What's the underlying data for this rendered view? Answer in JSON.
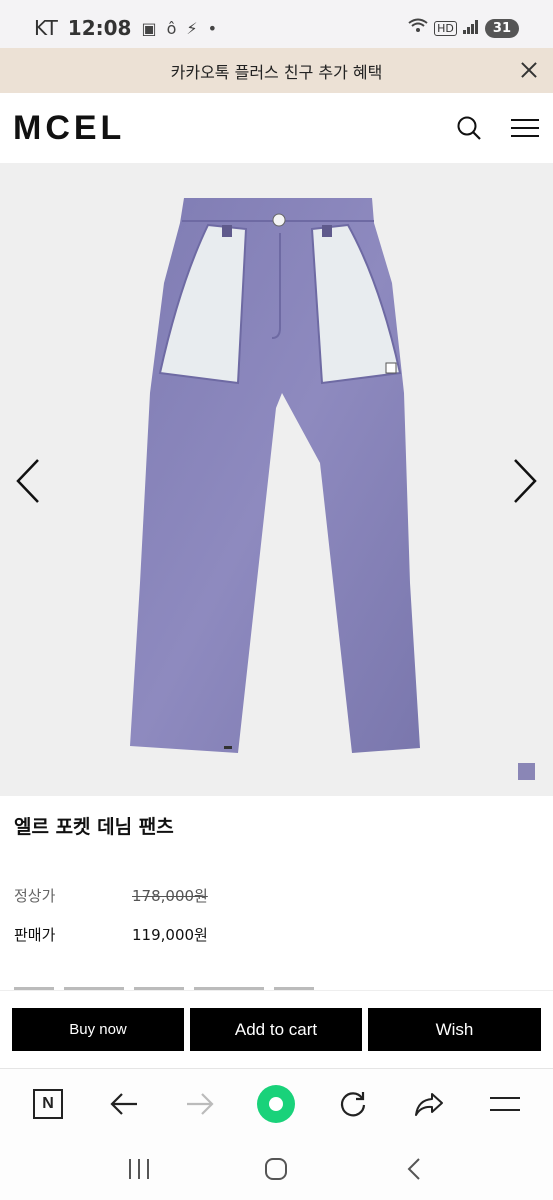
{
  "status_bar": {
    "carrier": "KT",
    "time": "12:08",
    "network": "HD",
    "battery": "31"
  },
  "promo": {
    "text": "카카오톡 플러스 친구 추가 혜택"
  },
  "header": {
    "logo": "MCEL",
    "icons": [
      "search-icon",
      "menu-icon"
    ]
  },
  "gallery": {
    "image_subject": "denim pants",
    "swatch_color": "#8a86b6"
  },
  "product": {
    "name": "엘르 포켓 데님 팬츠",
    "regular_price_label": "정상가",
    "regular_price": "178,000원",
    "sale_price_label": "판매가",
    "sale_price": "119,000원"
  },
  "actions": {
    "buy_now": "Buy now",
    "add_to_cart": "Add to cart",
    "wish": "Wish"
  },
  "browser_toolbar": {
    "items": [
      "naver-icon",
      "back-icon",
      "forward-icon",
      "green-dot-icon",
      "reload-icon",
      "share-icon",
      "menu-icon"
    ]
  },
  "android_nav": {
    "items": [
      "recents-icon",
      "home-icon",
      "back-icon"
    ]
  }
}
